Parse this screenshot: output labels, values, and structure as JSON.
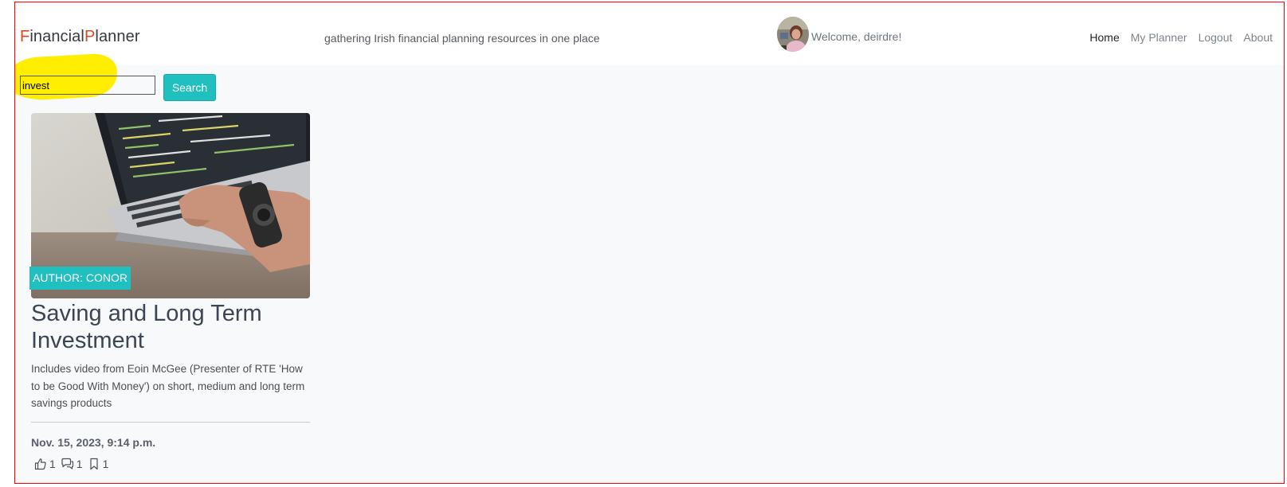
{
  "brand": {
    "first_initial": "F",
    "first_rest": "inancial",
    "second_initial": "P",
    "second_rest": "lanner"
  },
  "tagline": "gathering Irish financial planning resources in one place",
  "user": {
    "welcome": "Welcome, deirdre!"
  },
  "nav": {
    "home": "Home",
    "my_planner": "My Planner",
    "logout": "Logout",
    "about": "About"
  },
  "search": {
    "value": "invest",
    "button_label": "Search"
  },
  "post": {
    "author_badge": "AUTHOR: CONOR",
    "title": "Saving and Long Term Investment",
    "excerpt": "Includes video from Eoin McGee (Presenter of RTE 'How to be Good With Money') on short, medium and long term savings products",
    "date": "Nov. 15, 2023, 9:14 p.m.",
    "likes": "1",
    "comments": "1",
    "bookmarks": "1"
  },
  "colors": {
    "brand_accent": "#d94a1e",
    "primary_button": "#20bfc0",
    "highlight": "#ffee00",
    "frame_border": "#ff0000"
  },
  "icons": [
    "avatar-photo",
    "thumbs-up-icon",
    "comments-icon",
    "bookmark-icon"
  ]
}
